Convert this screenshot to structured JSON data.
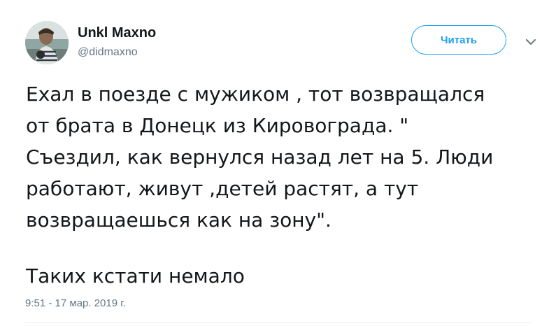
{
  "author": {
    "name": "Unkl Maxno",
    "handle": "@didmaxno"
  },
  "follow_button": {
    "label": "Читать"
  },
  "tweet": {
    "lines": [
      "Ехал в поезде с мужиком , тот возвращался",
      "от брата в Донецк из Кировограда. \"",
      "Съездил, как вернулся назад лет на 5. Люди",
      "работают, живут ,детей растят, а тут",
      "возвращаешься как на зону\"."
    ],
    "final_line": "Таких кстати немало",
    "timestamp": "9:51 - 17 мар. 2019 г."
  },
  "icons": {
    "avatar": "user-avatar-photo",
    "caret": "chevron-down-icon"
  },
  "colors": {
    "accent": "#1da1f2",
    "text": "#14171a",
    "secondary_text": "#657786",
    "divider": "#e6ecf0"
  }
}
